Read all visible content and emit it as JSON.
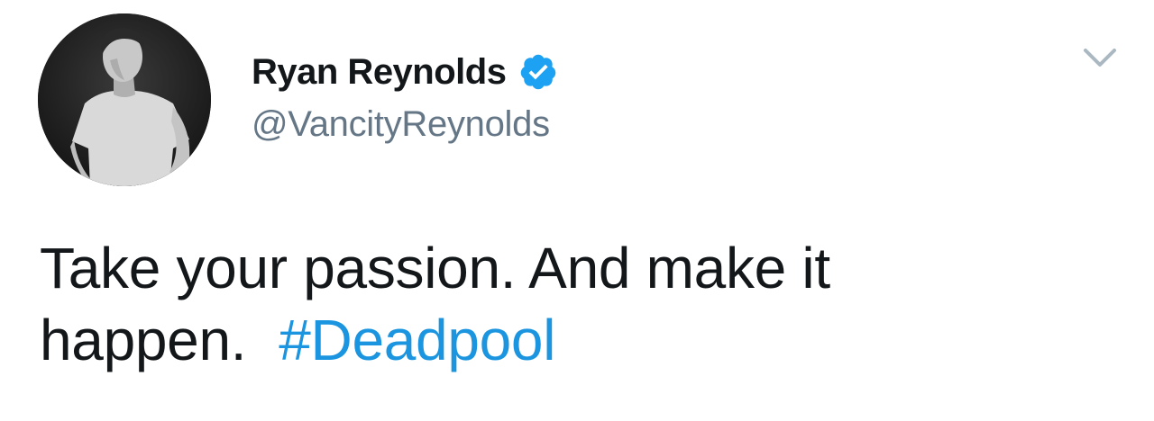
{
  "tweet": {
    "author": {
      "display_name": "Ryan Reynolds",
      "handle": "@VancityReynolds",
      "verified": true,
      "avatar_icon": "profile-photo"
    },
    "text_line_1": "Take your passion. And make it",
    "text_line_2": "happen.",
    "hashtag": "#Deadpool",
    "menu_icon": "chevron-down-icon"
  },
  "colors": {
    "name": "#14171a",
    "handle": "#657786",
    "hashtag": "#1b95e0",
    "verified": "#1da1f2",
    "caret": "#aab8c2"
  }
}
